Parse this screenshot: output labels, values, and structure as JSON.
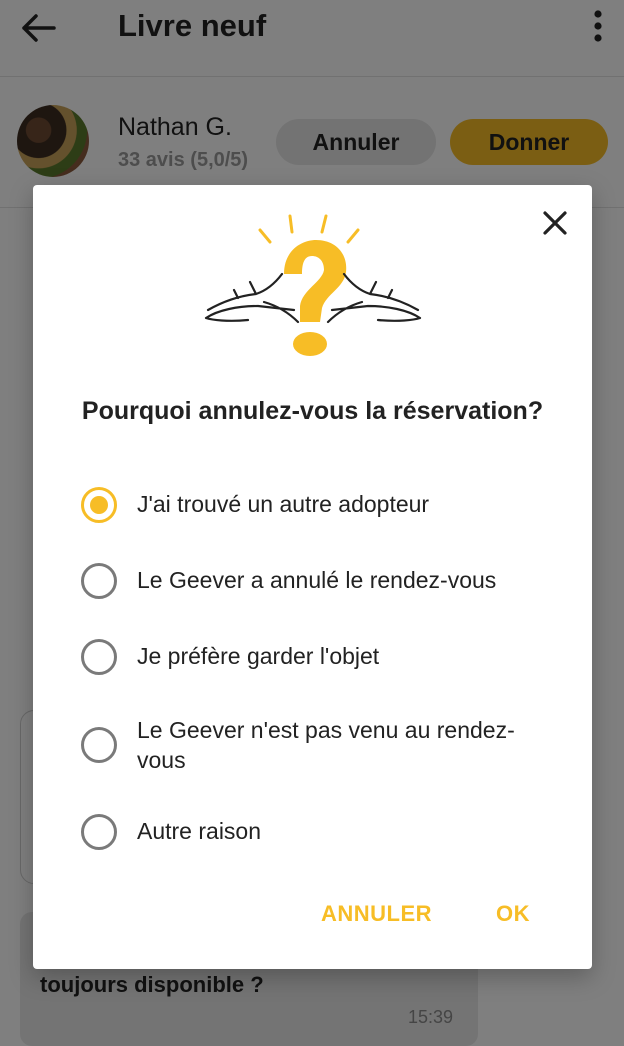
{
  "header": {
    "title": "Livre neuf",
    "back_icon": "arrow-left-icon",
    "menu_icon": "more-vertical-icon"
  },
  "user": {
    "name": "Nathan G.",
    "rating": "33 avis (5,0/5)",
    "cancel_label": "Annuler",
    "give_label": "Donner"
  },
  "chat": {
    "message": "toujours disponible ?",
    "time": "15:39"
  },
  "dialog": {
    "title": "Pourquoi annulez-vous la réservation?",
    "close_icon": "close-icon",
    "illustration": "question-hands-illustration",
    "options": [
      {
        "label": "J'ai trouvé un autre adopteur",
        "selected": true
      },
      {
        "label": "Le Geever a annulé le rendez-vous",
        "selected": false
      },
      {
        "label": "Je préfère garder l'objet",
        "selected": false
      },
      {
        "label": "Le Geever n'est pas venu au rendez-vous",
        "selected": false
      },
      {
        "label": "Autre raison",
        "selected": false
      }
    ],
    "cancel_label": "ANNULER",
    "ok_label": "OK"
  },
  "colors": {
    "accent": "#f7bd26",
    "radio_unselected": "#7a7a7a",
    "scrim": "rgba(0,0,0,0.5)"
  }
}
